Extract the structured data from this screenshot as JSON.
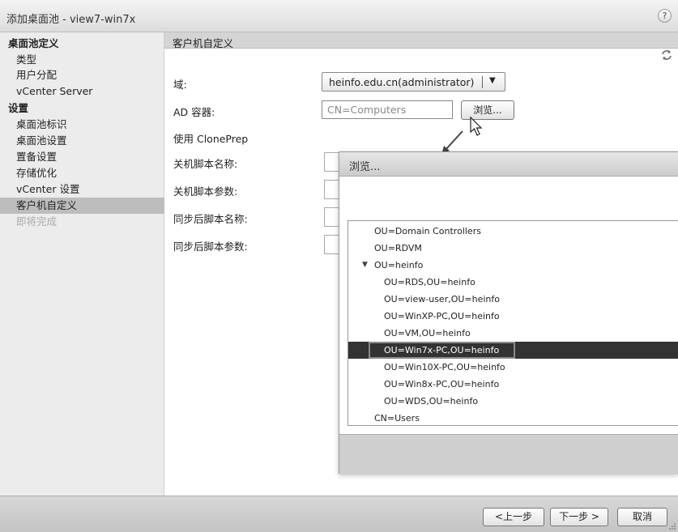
{
  "window": {
    "title": "添加桌面池 - view7-win7x",
    "help_label": "?"
  },
  "sidebar": {
    "items": [
      {
        "label": "桌面池定义",
        "kind": "head"
      },
      {
        "label": "类型",
        "kind": "item"
      },
      {
        "label": "用户分配",
        "kind": "item"
      },
      {
        "label": "vCenter Server",
        "kind": "item"
      },
      {
        "label": "设置",
        "kind": "head"
      },
      {
        "label": "桌面池标识",
        "kind": "item"
      },
      {
        "label": "桌面池设置",
        "kind": "item"
      },
      {
        "label": "置备设置",
        "kind": "item"
      },
      {
        "label": "存储优化",
        "kind": "item"
      },
      {
        "label": "vCenter 设置",
        "kind": "item"
      },
      {
        "label": "客户机自定义",
        "kind": "active"
      },
      {
        "label": "即将完成",
        "kind": "disabled"
      }
    ]
  },
  "main": {
    "header": "客户机自定义",
    "domain_label": "域:",
    "domain_value": "heinfo.edu.cn(administrator)",
    "ad_label": "AD 容器:",
    "ad_value": "CN=Computers",
    "browse_label": "浏览...",
    "cloneprep_label": "使用 ClonePrep",
    "shutdown_script_name_label": "关机脚本名称:",
    "shutdown_script_params_label": "关机脚本参数:",
    "post_sync_script_name_label": "同步后脚本名称:",
    "post_sync_script_params_label": "同步后脚本参数:"
  },
  "dialog": {
    "title": "浏览...",
    "tree": [
      {
        "label": "OU=Domain Controllers",
        "level": 0
      },
      {
        "label": "OU=RDVM",
        "level": 0
      },
      {
        "label": "OU=heinfo",
        "level": 0,
        "expanded": true
      },
      {
        "label": "OU=RDS,OU=heinfo",
        "level": 1
      },
      {
        "label": "OU=view-user,OU=heinfo",
        "level": 1
      },
      {
        "label": "OU=WinXP-PC,OU=heinfo",
        "level": 1
      },
      {
        "label": "OU=VM,OU=heinfo",
        "level": 1
      },
      {
        "label": "OU=Win7x-PC,OU=heinfo",
        "level": 1,
        "selected": true
      },
      {
        "label": "OU=Win10X-PC,OU=heinfo",
        "level": 1
      },
      {
        "label": "OU=Win8x-PC,OU=heinfo",
        "level": 1
      },
      {
        "label": "OU=WDS,OU=heinfo",
        "level": 1
      },
      {
        "label": "CN=Users",
        "level": 0
      }
    ],
    "expand_glyph": "▼"
  },
  "footer": {
    "back_label": "<上一步",
    "next_label": "下一步 >",
    "cancel_label": "取消"
  }
}
